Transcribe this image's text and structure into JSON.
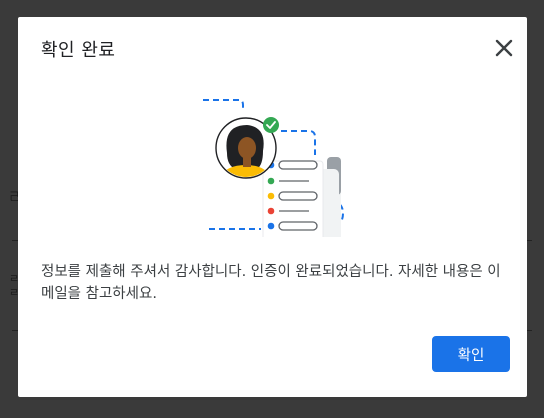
{
  "dialog": {
    "title": "확인 완료",
    "close_icon": "close-icon",
    "illustration": "verified-profile-illustration",
    "message": "정보를 제출해 주셔서 감사합니다. 인증이 완료되었습니다. 자세한 내용은 이메일을 참고하세요.",
    "confirm_label": "확인"
  },
  "background": {
    "glyphs": [
      "己",
      "ㄹ",
      "ㄹ"
    ]
  },
  "colors": {
    "primary": "#1a73e8",
    "check": "#34a853",
    "dot_blue": "#1a73e8",
    "dot_green": "#34a853",
    "dot_yellow": "#fbbc04",
    "dot_red": "#ea4335"
  }
}
